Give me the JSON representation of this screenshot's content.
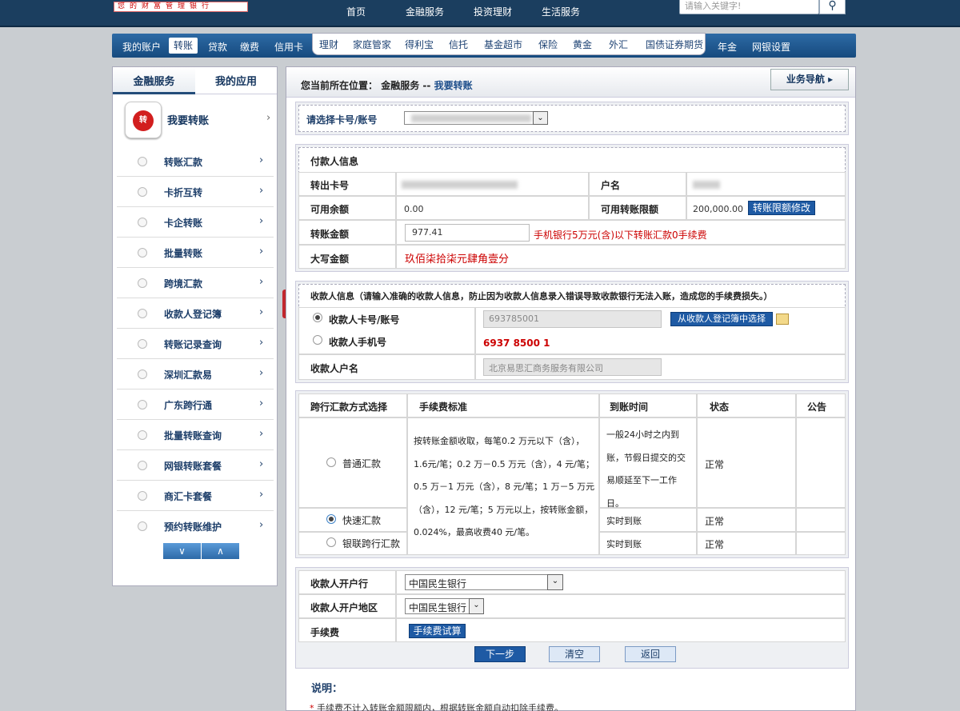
{
  "top": {
    "logo_text": "您的财富管理银行",
    "nav": [
      "首页",
      "金融服务",
      "投资理财",
      "生活服务"
    ],
    "search_placeholder": "请输入关键字!"
  },
  "menubar": {
    "items": [
      "我的账户",
      "转账",
      "贷款",
      "缴费",
      "信用卡"
    ],
    "active": "转账",
    "sub_items": [
      "理财",
      "家庭管家",
      "得利宝",
      "信托",
      "基金超市",
      "保险",
      "黄金",
      "外汇",
      "国债证券期货"
    ],
    "right_items": [
      "年金",
      "网银设置"
    ]
  },
  "sidebar": {
    "tabs": [
      "金融服务",
      "我的应用"
    ],
    "header_icon_text": "转",
    "header_label": "我要转账",
    "items": [
      {
        "label": "转账汇款"
      },
      {
        "label": "卡折互转"
      },
      {
        "label": "卡企转账"
      },
      {
        "label": "批量转账"
      },
      {
        "label": "跨境汇款"
      },
      {
        "label": "收款人登记簿"
      },
      {
        "label": "转账记录查询"
      },
      {
        "label": "深圳汇款易"
      },
      {
        "label": "广东跨行通"
      },
      {
        "label": "批量转账查询"
      },
      {
        "label": "网银转账套餐"
      },
      {
        "label": "商汇卡套餐"
      },
      {
        "label": "预约转账维护"
      }
    ]
  },
  "breadcrumb": {
    "prefix": "您当前所在位置：",
    "section": "金融服务",
    "sep": "--",
    "page": "我要转账"
  },
  "biz_nav_label": "业务导航",
  "card_select": {
    "label": "请选择卡号/账号"
  },
  "payer": {
    "title": "付款人信息",
    "card_label": "转出卡号",
    "name_label": "户名",
    "balance_label": "可用余额",
    "balance": "0.00",
    "limit_label": "可用转账限额",
    "limit": "200,000.00",
    "limit_btn": "转账限额修改",
    "amount_label": "转账金额",
    "amount": "977.41",
    "amount_note": "手机银行5万元(含)以下转账汇款0手续费",
    "capital_label": "大写金额",
    "capital": "玖佰柒拾柒元肆角壹分"
  },
  "payee": {
    "title": "收款人信息（请输入准确的收款人信息，防止因为收款人信息录入错误导致收款银行无法入账，造成您的手续费损失。）",
    "card_label": "收款人卡号/账号",
    "card_value": "693785001",
    "select_btn": "从收款人登记簿中选择",
    "phone_label": "收款人手机号",
    "phone_value": "6937  8500  1",
    "name_label": "收款人户名",
    "name_value": "北京易思汇商务服务有限公司"
  },
  "remit": {
    "headers": [
      "跨行汇款方式选择",
      "手续费标准",
      "到账时间",
      "状态",
      "公告"
    ],
    "fee_text": "按转账金额收取，每笔0.2 万元以下（含），1.6元/笔；0.2 万－0.5 万元（含），4 元/笔；0.5 万－1 万元（含），8 元/笔；1 万－5 万元（含），12 元/笔；5 万元以上，按转账金额，0.024%，最高收费40 元/笔。",
    "rows": [
      {
        "name": "普通汇款",
        "time": "一般24小时之内到账，节假日提交的交易顺延至下一工作日。",
        "status": "正常",
        "selected": false
      },
      {
        "name": "快速汇款",
        "time": "实时到账",
        "status": "正常",
        "selected": true
      },
      {
        "name": "银联跨行汇款",
        "time": "实时到账",
        "status": "正常",
        "selected": false
      }
    ]
  },
  "bank": {
    "bank_label": "收款人开户行",
    "bank_value": "中国民生银行",
    "region_label": "收款人开户地区",
    "region_value": "中国民生银行",
    "fee_label": "手续费",
    "fee_btn": "手续费试算"
  },
  "buttons": {
    "next": "下一步",
    "clear": "清空",
    "back": "返回"
  },
  "notes": {
    "title": "说明：",
    "item1": "手续费不计入转账金额限额内，根据转账金额自动扣除手续费。"
  }
}
